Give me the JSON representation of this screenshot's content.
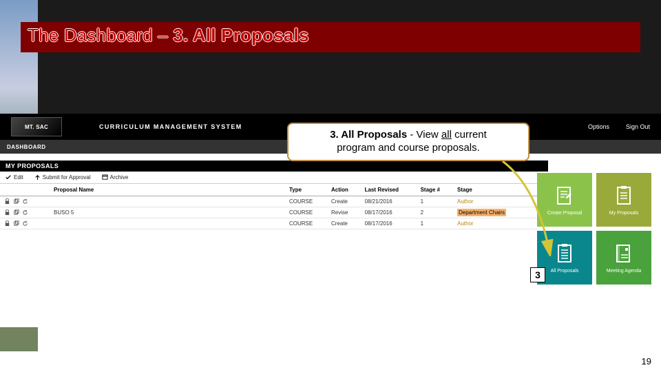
{
  "slide": {
    "title_prefix": "The Dashboard – ",
    "title_bold": "3. All Proposals",
    "page_number": "19",
    "callout_bold": "3. All Proposals",
    "callout_mid": " - View ",
    "callout_underline": "all",
    "callout_tail": " current",
    "callout_line2": "program and course proposals.",
    "number_badge": "3"
  },
  "app": {
    "logo_text": "MT. SAC",
    "cms_label": "CURRICULUM MANAGEMENT SYSTEM",
    "nav": {
      "options": "Options",
      "signout": "Sign Out"
    },
    "dashboard_label": "DASHBOARD",
    "my_proposals_header": "MY PROPOSALS",
    "toolbar": {
      "edit": "Edit",
      "submit": "Submit for Approval",
      "archive": "Archive"
    },
    "columns": {
      "blank": "",
      "proposal_name": "Proposal Name",
      "type": "Type",
      "action": "Action",
      "last_revised": "Last Revised",
      "stage_num": "Stage #",
      "stage": "Stage"
    },
    "rows": [
      {
        "name": "",
        "type": "COURSE",
        "action": "Create",
        "date": "08/21/2016",
        "stage_num": "1",
        "stage": "Author",
        "stage_class": "author"
      },
      {
        "name": "BUSO 5",
        "type": "COURSE",
        "action": "Revise",
        "date": "08/17/2016",
        "stage_num": "2",
        "stage": "Department Chairs",
        "stage_class": "dept"
      },
      {
        "name": "",
        "type": "COURSE",
        "action": "Create",
        "date": "08/17/2016",
        "stage_num": "1",
        "stage": "Author",
        "stage_class": "author"
      }
    ],
    "tiles": {
      "create": "Create Proposal",
      "my": "My Proposals",
      "all": "All Proposals",
      "meeting": "Meeting Agenda"
    }
  }
}
